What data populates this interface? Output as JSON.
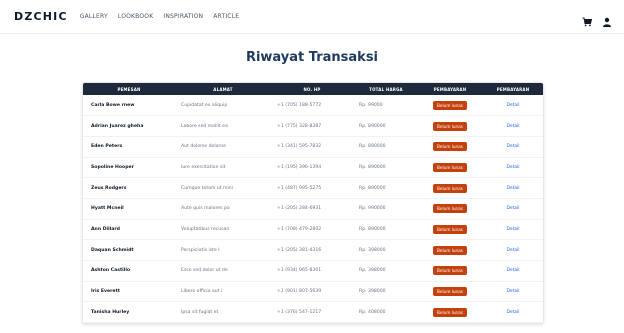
{
  "navbar": {
    "brand": "DZCHIC",
    "links": [
      "GALLERY",
      "LOOKBOOK",
      "INSPIRATION",
      "ARTICLE"
    ],
    "icons": [
      "cart-icon",
      "user-icon"
    ]
  },
  "page_title": "Riwayat Transaksi",
  "table": {
    "headers": [
      "PEMESAN",
      "ALAMAT",
      "NO. HP",
      "TOTAL HARGA",
      "PEMBAYARAN",
      "PEMBAYARAN"
    ],
    "rows": [
      {
        "name": "Carla Bowe rnew",
        "address": "Cupidatat ex aliquip",
        "phone": "+1 (705) 188-5772",
        "total": "Rp. 99000",
        "payment": "Belum lunas",
        "detail": "Detail"
      },
      {
        "name": "Adrian Juarez gheha",
        "address": "Labore sed mollit ea",
        "phone": "+1 (775) 328-8387",
        "total": "Rp. 890000",
        "payment": "Belum lunas",
        "detail": "Detail"
      },
      {
        "name": "Eden Peters",
        "address": "Aut dolores dolorne",
        "phone": "+1 (341) 595-7832",
        "total": "Rp. 890000",
        "payment": "Belum lunas",
        "detail": "Detail"
      },
      {
        "name": "Sopoline Hooper",
        "address": "Iure exercitation sit",
        "phone": "+1 (195) 396-1394",
        "total": "Rp. 890000",
        "payment": "Belum lunas",
        "detail": "Detail"
      },
      {
        "name": "Zeus Rodgers",
        "address": "Cumque totam ut mini",
        "phone": "+1 (487) 995-5275",
        "total": "Rp. 890000",
        "payment": "Belum lunas",
        "detail": "Detail"
      },
      {
        "name": "Hyatt Mcneil",
        "address": "Aute quis maiores po",
        "phone": "+1 (205) 284-6931",
        "total": "Rp. 990000",
        "payment": "Belum lunas",
        "detail": "Detail"
      },
      {
        "name": "Ann Dillard",
        "address": "Voluptatibus recusan",
        "phone": "+1 (708) 479-2802",
        "total": "Rp. 890000",
        "payment": "Belum lunas",
        "detail": "Detail"
      },
      {
        "name": "Daquan Schmidt",
        "address": "Perspiciatis iste l",
        "phone": "+1 (205) 381-4316",
        "total": "Rp. 398000",
        "payment": "Belum lunas",
        "detail": "Detail"
      },
      {
        "name": "Ashton Castillo",
        "address": "Esse sed dolor ut de",
        "phone": "+1 (934) 965-8301",
        "total": "Rp. 398000",
        "payment": "Belum lunas",
        "detail": "Detail"
      },
      {
        "name": "Iris Everett",
        "address": "Libero officia aut i",
        "phone": "+1 (901) 807-5639",
        "total": "Rp. 398000",
        "payment": "Belum lunas",
        "detail": "Detail"
      },
      {
        "name": "Tanisha Hurley",
        "address": "Ipsa sit fugiat et",
        "phone": "+1 (376) 547-1217",
        "total": "Rp. 408000",
        "payment": "Belum lunas",
        "detail": "Detail"
      }
    ]
  },
  "colors": {
    "header_bg": "#1e293b",
    "badge_bg": "#c2410c",
    "link": "#2563eb",
    "title": "#1e3a5f"
  }
}
